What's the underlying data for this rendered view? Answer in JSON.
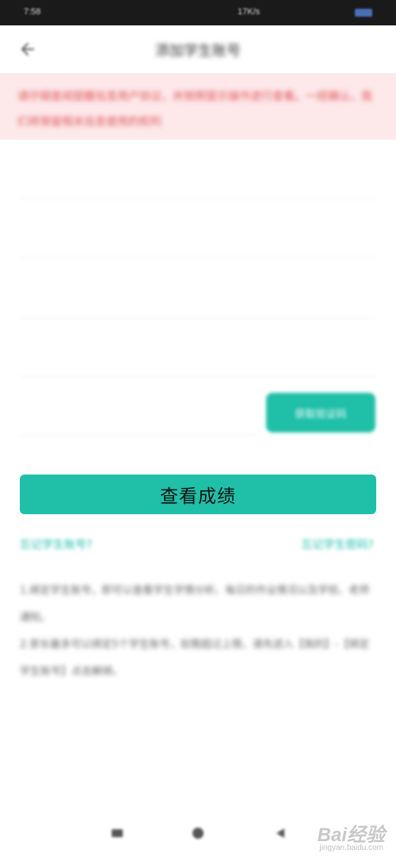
{
  "status_bar": {
    "time": "7:58",
    "network": "17K/s"
  },
  "header": {
    "title": "添加学生账号"
  },
  "notice": {
    "text": "请仔细查阅提醒信息用户协议，并按照提示操作进行查看。一经确认，我们将保留相关信息使用的权利"
  },
  "actions": {
    "get_code_label": "获取验证码",
    "primary_label": "查看成绩",
    "forgot_account": "忘记学生账号?",
    "forgot_password": "忘记学生密码?"
  },
  "instructions": {
    "line1": "1.绑定学生账号，即可以查看学生学情分析、每日的作业情况以及学校、老师通知。",
    "line2": "2.家长最多可以绑定5个学生账号，如需超过上限，请先进入【我的】-【绑定学生账号】点击解绑。"
  },
  "watermark": {
    "logo": "Bai经验",
    "url": "jingyan.baidu.com"
  },
  "colors": {
    "accent": "#1fbfa8",
    "notice_bg": "#fde8ea",
    "notice_text": "#e05555"
  }
}
